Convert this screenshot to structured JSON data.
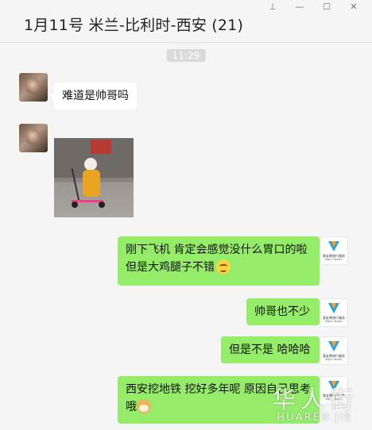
{
  "window": {
    "controls": [
      {
        "name": "pin-icon",
        "glyph": "⊥"
      },
      {
        "name": "minimize-icon",
        "glyph": "—"
      },
      {
        "name": "maximize-icon",
        "glyph": "☐"
      },
      {
        "name": "close-icon",
        "glyph": "✕"
      }
    ]
  },
  "header": {
    "title": "1月11号 米兰-比利时-西安 (21)"
  },
  "chat": {
    "timestamp": "11:29",
    "messages": [
      {
        "side": "left",
        "type": "text",
        "text": "难道是帅哥吗"
      },
      {
        "side": "left",
        "type": "image",
        "alt": "child on scooter photo"
      },
      {
        "side": "right",
        "type": "text",
        "line1": "刚下飞机 肯定会感觉没什么胃口的啦",
        "line2": "但是大鸡腿子不错",
        "emoji": "smile-emoji"
      },
      {
        "side": "right",
        "type": "text",
        "text": "帅哥也不少"
      },
      {
        "side": "right",
        "type": "text",
        "text": "但是不是 哈哈哈"
      },
      {
        "side": "right",
        "type": "text",
        "line1": "西安挖地铁 挖好多年呢 原因自己思考",
        "line2": "哦",
        "emoji": "dog-emoji"
      }
    ]
  },
  "brand_logo": {
    "line1": "意友朝旅行服务",
    "line2": "ENJOY TRAVEL"
  },
  "watermark": {
    "cn": "华人街",
    "en": "HUAREN.JIE"
  },
  "colors": {
    "bubble_self": "#95ec69",
    "bubble_other": "#ffffff",
    "background": "#f5f5f5"
  }
}
